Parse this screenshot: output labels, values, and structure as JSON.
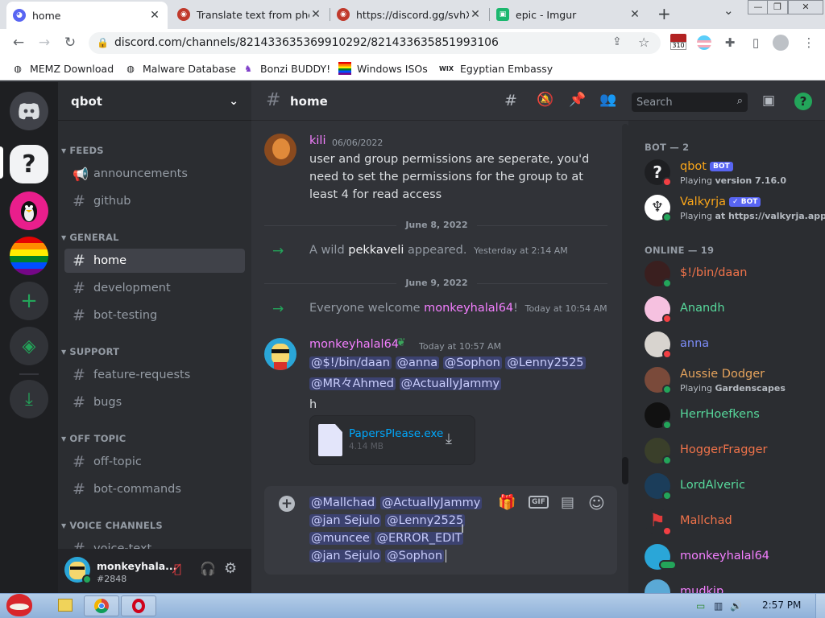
{
  "browser": {
    "tabs": [
      {
        "title": "home",
        "close": "✕"
      },
      {
        "title": "Translate text from pho",
        "close": "✕"
      },
      {
        "title": "https://discord.gg/svhX",
        "close": "✕"
      },
      {
        "title": "epic - Imgur",
        "close": "✕"
      }
    ],
    "new_tab": "+",
    "tab_search": "⌄",
    "window_controls": [
      "—",
      "❐",
      "✕"
    ],
    "url": "discord.com/channels/821433635369910292/821433635851993106",
    "extension_badge": "310",
    "bookmarks": [
      {
        "label": "MEMZ Download",
        "icon": "globe-icon"
      },
      {
        "label": "Malware Database",
        "icon": "globe-icon"
      },
      {
        "label": "Bonzi BUDDY!",
        "icon": "bonzi-icon"
      },
      {
        "label": "Windows ISOs",
        "icon": "rainbow-flag-icon"
      },
      {
        "label": "Egyptian Embassy",
        "icon": "wix-icon"
      }
    ],
    "wix_label": "WIX"
  },
  "server": {
    "name": "qbot",
    "categories": [
      {
        "label": "FEEDS",
        "channels": [
          {
            "label": "announcements",
            "icon": "megaphone-icon"
          },
          {
            "label": "github",
            "icon": "hash-icon"
          }
        ]
      },
      {
        "label": "GENERAL",
        "channels": [
          {
            "label": "home",
            "selected": true
          },
          {
            "label": "development"
          },
          {
            "label": "bot-testing"
          }
        ]
      },
      {
        "label": "SUPPORT",
        "channels": [
          {
            "label": "feature-requests"
          },
          {
            "label": "bugs"
          }
        ]
      },
      {
        "label": "OFF TOPIC",
        "channels": [
          {
            "label": "off-topic"
          },
          {
            "label": "bot-commands"
          }
        ]
      },
      {
        "label": "VOICE CHANNELS",
        "channels": [
          {
            "label": "voice-text"
          }
        ]
      }
    ],
    "hash": "#"
  },
  "user_panel": {
    "name": "monkeyhala...",
    "tag": "#2848"
  },
  "topbar": {
    "channel": "home",
    "hash": "#",
    "search_placeholder": "Search"
  },
  "messages": {
    "m1": {
      "author": "kili",
      "time": "06/06/2022",
      "text": [
        "user and group permissions are seperate, you'd",
        "need to set the permissions for the group to at",
        "least 4 for read access"
      ],
      "color": "#f47fff"
    },
    "div1": "June 8, 2022",
    "sys1": {
      "pre": "A wild ",
      "user": "pekkaveli",
      "post": " appeared.",
      "time": "Yesterday at 2:14 AM"
    },
    "div2": "June 9, 2022",
    "sys2": {
      "pre": "Everyone welcome ",
      "user": "monkeyhalal64",
      "post": "!",
      "time": "Today at 10:54 AM"
    },
    "m2": {
      "author": "monkeyhalal64",
      "time": "Today at 10:57 AM",
      "mentions_line1": [
        "@$!/bin/daan",
        "@anna",
        "@Sophon",
        "@Lenny2525"
      ],
      "mentions_line2": [
        "@MR々Ahmed",
        "@ActuallyJammy"
      ],
      "text": "h",
      "color": "#f47fff"
    },
    "attachment": {
      "name": "PapersPlease.exe",
      "size": "4.14 MB"
    }
  },
  "composer": {
    "lines": [
      [
        "@Mallchad",
        "@ActuallyJammy"
      ],
      [
        "@jan Sejulo",
        "@Lenny2525"
      ],
      [
        "@muncee",
        "@ERROR_EDIT"
      ],
      [
        "@jan Sejulo",
        "@Sophon"
      ]
    ],
    "gif": "GIF"
  },
  "members": {
    "groups": [
      {
        "label": "BOT — 2",
        "items": [
          {
            "name": "qbot",
            "color": "#faa61a",
            "badge": "BOT",
            "activity_pre": "Playing ",
            "activity": "version 7.16.0",
            "status": "dnd"
          },
          {
            "name": "Valkyrja",
            "color": "#faa61a",
            "badge": "✓ BOT",
            "activity_pre": "Playing ",
            "activity": "at https://valkyrja.app",
            "status": "online"
          }
        ]
      },
      {
        "label": "ONLINE — 19",
        "items": [
          {
            "name": "$!/bin/daan",
            "color": "#f0734a",
            "status": "online"
          },
          {
            "name": "Anandh",
            "color": "#57d99c",
            "status": "dnd"
          },
          {
            "name": "anna",
            "color": "#7c8cf8",
            "status": "dnd"
          },
          {
            "name": "Aussie Dodger",
            "color": "#e5a35c",
            "activity_pre": "Playing ",
            "activity": "Gardenscapes",
            "status": "online"
          },
          {
            "name": "HerrHoefkens",
            "color": "#57d99c",
            "status": "online"
          },
          {
            "name": "HoggerFragger",
            "color": "#f0734a",
            "status": "online"
          },
          {
            "name": "LordAlveric",
            "color": "#57d99c",
            "status": "online"
          },
          {
            "name": "Mallchad",
            "color": "#f0734a",
            "status": "dnd"
          },
          {
            "name": "monkeyhalal64",
            "color": "#f47fff",
            "status": "mobile"
          },
          {
            "name": "mudkip",
            "color": "#f47fff",
            "status": "online"
          }
        ]
      }
    ]
  },
  "taskbar": {
    "time": "2:57 PM"
  },
  "colors": {
    "online": "#23a55a",
    "dnd": "#f23f43",
    "blurple": "#5865f2"
  }
}
